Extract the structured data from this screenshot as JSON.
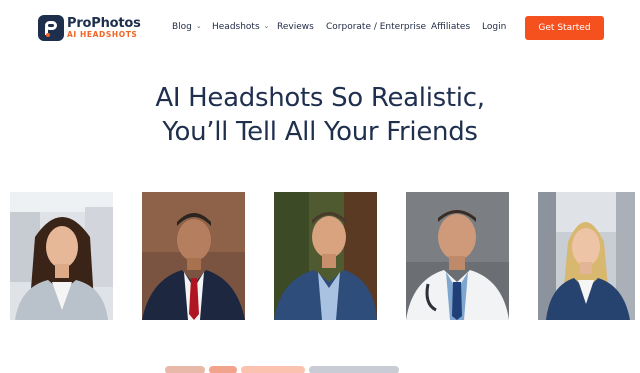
{
  "brand": {
    "name": "ProPhotos",
    "tagline": "AI HEADSHOTS",
    "accent": "#f26524",
    "navy": "#1e2f4d"
  },
  "nav": {
    "items": [
      {
        "label": "Blog",
        "dropdown": true
      },
      {
        "label": "Headshots",
        "dropdown": true
      },
      {
        "label": "Reviews",
        "dropdown": false
      },
      {
        "label": "Corporate / Enterprise",
        "dropdown": false
      },
      {
        "label": "Affiliates",
        "dropdown": false
      },
      {
        "label": "Login",
        "dropdown": false
      }
    ],
    "cta": "Get Started",
    "cta_color": "#f4511e"
  },
  "hero": {
    "line1": "AI Headshots So Realistic,",
    "line2": "You’ll Tell All Your Friends"
  },
  "gallery": [
    {
      "subject": "woman-office-headshot"
    },
    {
      "subject": "man-suit-red-tie-headshot"
    },
    {
      "subject": "man-blazer-outdoor-headshot"
    },
    {
      "subject": "doctor-white-coat-headshot"
    },
    {
      "subject": "blonde-woman-office-headshot"
    }
  ]
}
